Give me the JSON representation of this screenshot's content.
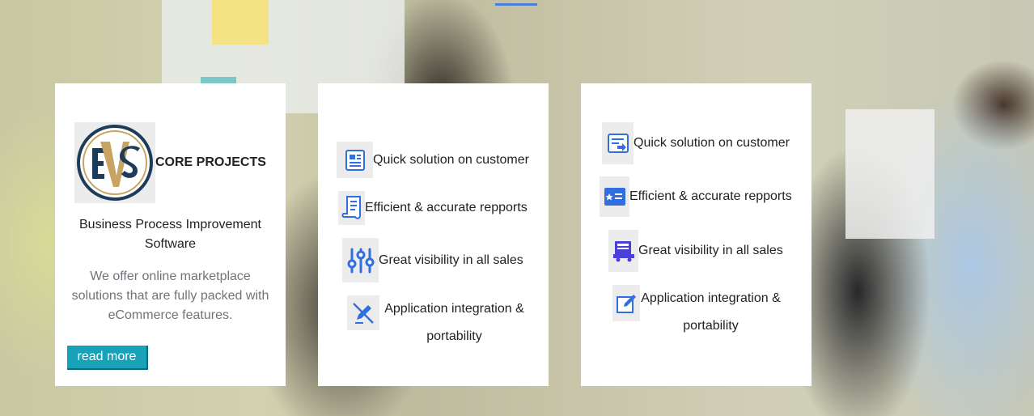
{
  "colors": {
    "accent": "#17a2b8",
    "nav_underline": "#4a7fd6",
    "icon_blue": "#2f6fe0"
  },
  "card1": {
    "logo_text": "EVS",
    "brand_name": "CORE PROJECTS",
    "subtitle": "Business Process Improvement Software",
    "description": "We offer online marketplace solutions that are fully packed with eCommerce features.",
    "read_more": "read more"
  },
  "card2": {
    "features": [
      {
        "icon": "document-icon",
        "label": "Quick solution on customer"
      },
      {
        "icon": "scroll-icon",
        "label": "Efficient & accurate repports"
      },
      {
        "icon": "sliders-icon",
        "label": "Great visibility in all sales"
      },
      {
        "icon": "edit-off-icon",
        "label": "Application integration & portability"
      }
    ]
  },
  "card3": {
    "features": [
      {
        "icon": "form-icon",
        "label": "Quick solution on customer"
      },
      {
        "icon": "list-card-icon",
        "label": "Efficient & accurate repports"
      },
      {
        "icon": "delivery-truck-icon",
        "label": "Great visibility in all sales"
      },
      {
        "icon": "edit-icon",
        "label": "Application integration & portability"
      }
    ]
  }
}
